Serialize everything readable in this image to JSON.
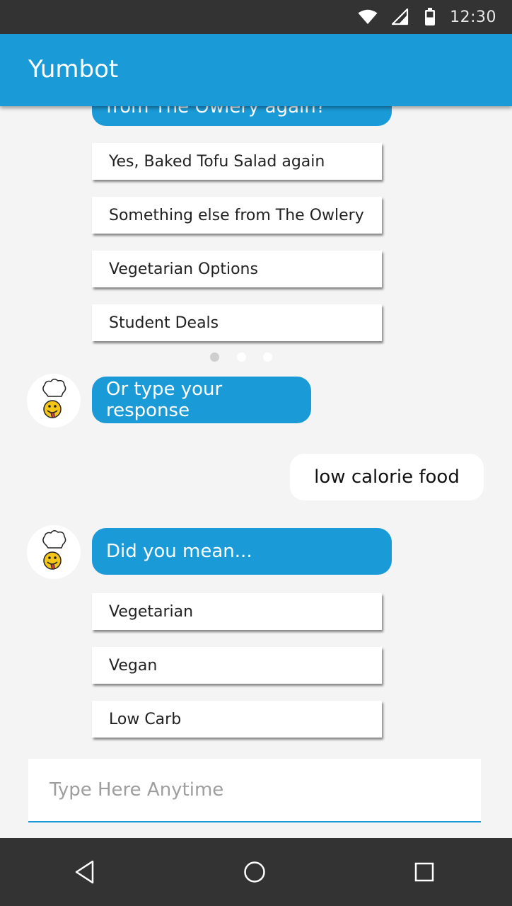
{
  "status_bar": {
    "time": "12:30",
    "icons": [
      "wifi-icon",
      "signal-icon",
      "battery-icon"
    ]
  },
  "app_bar": {
    "title": "Yumbot"
  },
  "chat": {
    "cut_off_bubble": {
      "text": "from The Owlery again?"
    },
    "options_group_1": [
      {
        "label": "Yes, Baked Tofu Salad again"
      },
      {
        "label": "Something else from The Owlery"
      },
      {
        "label": "Vegetarian Options"
      },
      {
        "label": "Student Deals"
      }
    ],
    "pager_dots": {
      "count": 3,
      "active_index": 0
    },
    "bot_message_1": {
      "text": "Or type your response"
    },
    "user_message": {
      "text": "low calorie food"
    },
    "bot_message_2": {
      "text": "Did you mean..."
    },
    "options_group_2": [
      {
        "label": "Vegetarian"
      },
      {
        "label": "Vegan"
      },
      {
        "label": "Low Carb"
      }
    ]
  },
  "input": {
    "placeholder": "Type Here Anytime",
    "value": ""
  },
  "nav_bar": {
    "buttons": [
      "back-icon",
      "home-icon",
      "recents-icon"
    ]
  },
  "colors": {
    "accent": "#1a9bd7",
    "status_bar": "#333333",
    "background": "#f4f4f4",
    "nav_bar": "#333333"
  }
}
